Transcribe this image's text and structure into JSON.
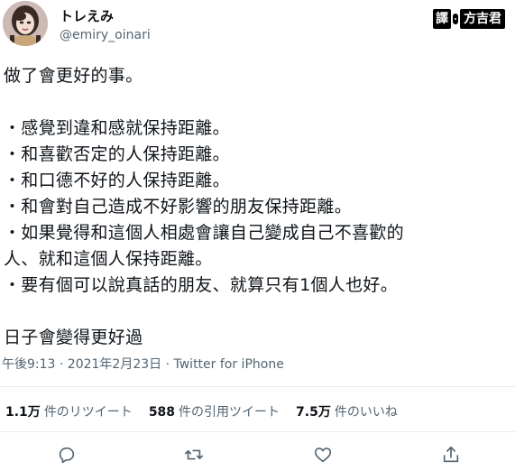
{
  "author": {
    "display_name": "トレえみ",
    "handle": "@emiry_oinari"
  },
  "translator_badge": {
    "label": "譯",
    "name": "方吉君"
  },
  "tweet": {
    "lines": [
      "做了會更好的事。",
      "",
      "・感覺到違和感就保持距離。",
      "・和喜歡否定的人保持距離。",
      "・和口德不好的人保持距離。",
      "・和會對自己造成不好影響的朋友保持距離。",
      "・如果覺得和這個人相處會讓自己變成自己不喜歡的",
      "人、就和這個人保持距離。",
      "・要有個可以說真話的朋友、就算只有1個人也好。",
      "",
      "日子會變得更好過"
    ]
  },
  "meta": {
    "timestamp": "午後9:13 · 2021年2月23日 · Twitter for iPhone"
  },
  "stats": [
    {
      "value": "1.1万",
      "label": "件のリツイート"
    },
    {
      "value": "588",
      "label": "件の引用ツイート"
    },
    {
      "value": "7.5万",
      "label": "件のいいね"
    }
  ],
  "actions": [
    "reply-icon",
    "retweet-icon",
    "like-icon",
    "share-icon"
  ],
  "colors": {
    "text": "#0f1419",
    "secondary": "#536471",
    "divider": "#e6ecf0",
    "icon": "#536471"
  }
}
